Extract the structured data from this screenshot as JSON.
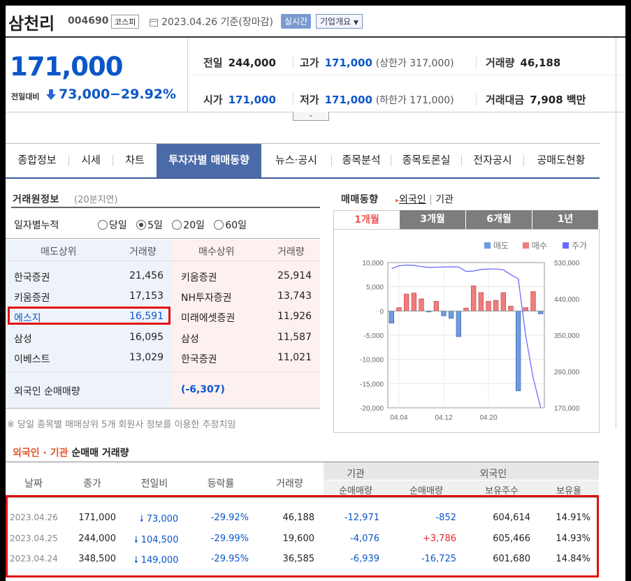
{
  "header": {
    "stock_name": "삼천리",
    "stock_code": "004690",
    "market_badge": "코스피",
    "date_text": "2023.04.26 기준(장마감)",
    "realtime_button": "실시간",
    "company_button": "기업개요"
  },
  "price": {
    "current": "171,000",
    "change_label": "전일대비",
    "change": "73,000",
    "change_pct": "−29.92%",
    "prev_close_label": "전일",
    "prev_close": "244,000",
    "high_label": "고가",
    "high": "171,000",
    "upper_limit": "(상한가 317,000)",
    "volume_label": "거래량",
    "volume": "46,188",
    "open_label": "시가",
    "open": "171,000",
    "low_label": "저가",
    "low": "171,000",
    "lower_limit": "(하한가 171,000)",
    "amount_label": "거래대금",
    "amount": "7,908 백만"
  },
  "tabs": [
    "종합정보",
    "시세",
    "차트",
    "투자자별 매매동향",
    "뉴스·공시",
    "종목분석",
    "종목토론실",
    "전자공시",
    "공매도현황"
  ],
  "broker": {
    "title": "거래원정보",
    "delay": "(20분지연)",
    "period_label": "일자별누적",
    "periods": [
      "당일",
      "5일",
      "20일",
      "60일"
    ],
    "selected_period": "5일",
    "sell_header": "매도상위",
    "sell_vol_header": "거래량",
    "buy_header": "매수상위",
    "buy_vol_header": "거래량",
    "sellers": [
      {
        "name": "한국증권",
        "vol": "21,456"
      },
      {
        "name": "키움증권",
        "vol": "17,153"
      },
      {
        "name": "에스지",
        "vol": "16,591"
      },
      {
        "name": "삼성",
        "vol": "16,095"
      },
      {
        "name": "이베스트",
        "vol": "13,029"
      }
    ],
    "buyers": [
      {
        "name": "키움증권",
        "vol": "25,914"
      },
      {
        "name": "NH투자증권",
        "vol": "13,743"
      },
      {
        "name": "미래에셋증권",
        "vol": "11,926"
      },
      {
        "name": "삼성",
        "vol": "11,587"
      },
      {
        "name": "한국증권",
        "vol": "11,021"
      }
    ],
    "foreign_net_label": "외국인 순매매량",
    "foreign_net": "(-6,307)",
    "note": "※ 당일 종목별 매매상위 5개 회원사 정보를 이용한 추정치임"
  },
  "trade_chart": {
    "title": "매매동향",
    "filter_foreign": "외국인",
    "filter_inst": "기관",
    "period_tabs": [
      "1개월",
      "3개월",
      "6개월",
      "1년"
    ],
    "active_period": "1개월",
    "legend": [
      "매도",
      "매수",
      "주가"
    ],
    "colors": {
      "sell": "#6f9be0",
      "buy": "#f07c7c",
      "price": "#6b6bff"
    }
  },
  "chart_data": {
    "type": "bar",
    "y_left_ticks": [
      "10,000",
      "5,000",
      "0",
      "-5,000",
      "-10,000",
      "-15,000",
      "-20,000"
    ],
    "y_left_range": [
      -20000,
      10000
    ],
    "y_right_ticks": [
      "530,000",
      "440,000",
      "350,000",
      "260,000",
      "170,000"
    ],
    "y_right_range": [
      170000,
      530000
    ],
    "x_ticks": [
      "04.04",
      "04.12",
      "04.20"
    ],
    "series": [
      {
        "values": [
          -2500,
          700,
          3500,
          3700,
          2500,
          -200,
          2000,
          -1000,
          -1500,
          -5300,
          600,
          5200,
          3800,
          2000,
          2200,
          3800,
          1000,
          -16500,
          700,
          4000,
          -600
        ]
      },
      {
        "values": [
          515000,
          522000,
          524000,
          523000,
          520000,
          518000,
          518500,
          519000,
          519500,
          519000,
          508000,
          509000,
          513000,
          514000,
          514000,
          512000,
          500000,
          490000,
          348500,
          244000,
          171000
        ]
      }
    ]
  },
  "net_table": {
    "title_foreign": "외국인",
    "title_sep": "·",
    "title_inst": "기관",
    "title_rest": "순매매 거래량",
    "headers": [
      "날짜",
      "종가",
      "전일비",
      "등락률",
      "거래량"
    ],
    "group_inst": "기관",
    "group_foreign": "외국인",
    "sub_inst_net": "순매매량",
    "sub_foreign_net": "순매매량",
    "sub_holdings": "보유주수",
    "sub_ratio": "보유율",
    "rows": [
      {
        "date": "2023.04.26",
        "close": "171,000",
        "change": "73,000",
        "rate": "-29.92%",
        "volume": "46,188",
        "inst_net": "-12,971",
        "foreign_net": "-852",
        "holdings": "604,614",
        "ratio": "14.91%"
      },
      {
        "date": "2023.04.25",
        "close": "244,000",
        "change": "104,500",
        "rate": "-29.99%",
        "volume": "19,600",
        "inst_net": "-4,076",
        "foreign_net": "+3,786",
        "holdings": "605,466",
        "ratio": "14.93%"
      },
      {
        "date": "2023.04.24",
        "close": "348,500",
        "change": "149,000",
        "rate": "-29.95%",
        "volume": "36,585",
        "inst_net": "-6,939",
        "foreign_net": "-16,725",
        "holdings": "601,680",
        "ratio": "14.84%"
      }
    ]
  }
}
